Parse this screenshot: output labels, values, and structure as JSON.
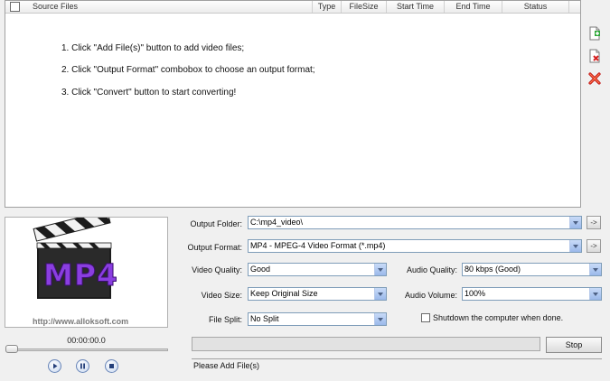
{
  "file_list": {
    "columns": [
      "Source Files",
      "Type",
      "FileSize",
      "Start Time",
      "End Time",
      "Status"
    ],
    "instructions": [
      "1. Click \"Add File(s)\" button to add video files;",
      "2. Click \"Output Format\" combobox to choose an output format;",
      "3. Click \"Convert\" button to start converting!"
    ]
  },
  "side_toolbar": {
    "icons": [
      "add-file-icon",
      "remove-file-icon",
      "clear-list-icon"
    ]
  },
  "preview": {
    "logo_text": "MP4",
    "url": "http://www.alloksoft.com",
    "time": "00:00:00.0"
  },
  "settings": {
    "output_folder_label": "Output Folder:",
    "output_folder_value": "C:\\mp4_video\\",
    "output_format_label": "Output Format:",
    "output_format_value": "MP4 - MPEG-4 Video Format (*.mp4)",
    "video_quality_label": "Video Quality:",
    "video_quality_value": "Good",
    "audio_quality_label": "Audio Quality:",
    "audio_quality_value": "80  kbps (Good)",
    "video_size_label": "Video Size:",
    "video_size_value": "Keep Original Size",
    "audio_volume_label": "Audio Volume:",
    "audio_volume_value": "100%",
    "file_split_label": "File Split:",
    "file_split_value": "No Split",
    "shutdown_label": "Shutdown the computer when done.",
    "browse_label": "->"
  },
  "progress": {
    "fraction": 0
  },
  "stop_label": "Stop",
  "status_text": "Please Add File(s)",
  "colors": {
    "accent": "#3a7bd5",
    "combo_border": "#7f9db9",
    "logo_purple": "#7a28c8"
  }
}
